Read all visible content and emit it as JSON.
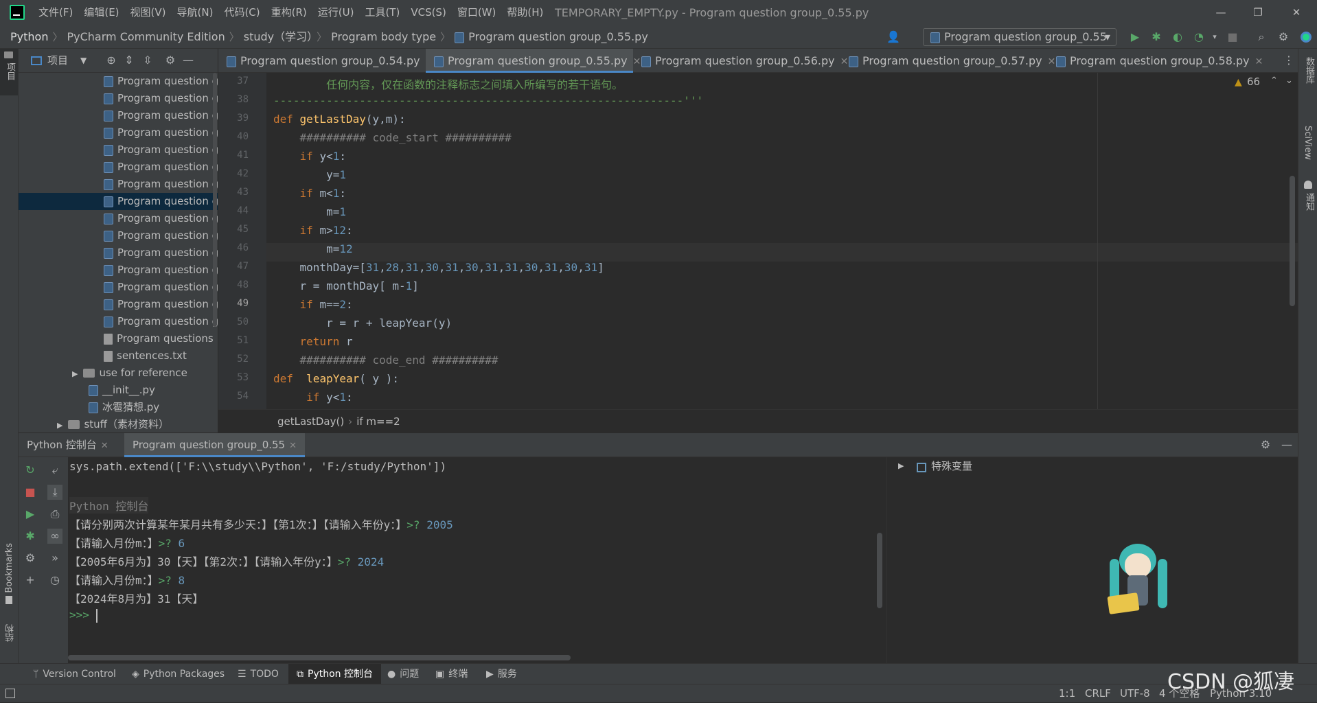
{
  "window": {
    "title": "TEMPORARY_EMPTY.py - Program question group_0.55.py",
    "menu": [
      "文件(F)",
      "编辑(E)",
      "视图(V)",
      "导航(N)",
      "代码(C)",
      "重构(R)",
      "运行(U)",
      "工具(T)",
      "VCS(S)",
      "窗口(W)",
      "帮助(H)"
    ],
    "minimize": "—",
    "restore": "❐",
    "close": "✕"
  },
  "breadcrumb": {
    "items": [
      "Python",
      "PyCharm Community Edition",
      "study（学习）",
      "Program body type",
      "Program question group_0.55.py"
    ]
  },
  "run_config": {
    "label": "Program question group_0.55",
    "dropdown_arrow": "▾"
  },
  "project_panel": {
    "title": "项目",
    "tree": [
      {
        "label": "Program question g",
        "kind": "py"
      },
      {
        "label": "Program question g",
        "kind": "py"
      },
      {
        "label": "Program question g",
        "kind": "py"
      },
      {
        "label": "Program question g",
        "kind": "py"
      },
      {
        "label": "Program question g",
        "kind": "py"
      },
      {
        "label": "Program question g",
        "kind": "py"
      },
      {
        "label": "Program question g",
        "kind": "py"
      },
      {
        "label": "Program question g",
        "kind": "py",
        "selected": true
      },
      {
        "label": "Program question g",
        "kind": "py"
      },
      {
        "label": "Program question g",
        "kind": "py"
      },
      {
        "label": "Program question g",
        "kind": "py"
      },
      {
        "label": "Program question g",
        "kind": "py"
      },
      {
        "label": "Program question g",
        "kind": "py"
      },
      {
        "label": "Program question g",
        "kind": "py"
      },
      {
        "label": "Program question g",
        "kind": "py"
      },
      {
        "label": "Program questions",
        "kind": "txt"
      },
      {
        "label": "sentences.txt",
        "kind": "txt"
      },
      {
        "label": "use for reference",
        "kind": "folder"
      },
      {
        "label": "__init__.py",
        "kind": "py"
      },
      {
        "label": "冰雹猜想.py",
        "kind": "py"
      },
      {
        "label": "stuff（素材资料）",
        "kind": "folder"
      }
    ]
  },
  "left_toolbar": {
    "project_label": "项目",
    "bookmarks_label": "Bookmarks",
    "structure_label": "结构"
  },
  "right_toolbar": {
    "database_label": "数据库",
    "sciview_label": "SciView",
    "notifications_label": "通知"
  },
  "tabs": [
    {
      "label": "Program question group_0.54.py",
      "active": false
    },
    {
      "label": "Program question group_0.55.py",
      "active": true
    },
    {
      "label": "Program question group_0.56.py",
      "active": false
    },
    {
      "label": "Program question group_0.57.py",
      "active": false
    },
    {
      "label": "Program question group_0.58.py",
      "active": false
    }
  ],
  "editor": {
    "warnings_count": "66",
    "line_numbers": [
      "37",
      "38",
      "39",
      "40",
      "41",
      "42",
      "43",
      "44",
      "45",
      "46",
      "47",
      "48",
      "49",
      "50",
      "51",
      "52",
      "53",
      "54"
    ],
    "code_lines": [
      "        任何内容，仅在函数的注释标志之间填入所编写的若干语句。",
      "--------------------------------------------------------------'''",
      "def getLastDay(y,m):",
      "    ########## code_start ##########",
      "    if y<1:",
      "        y=1",
      "    if m<1:",
      "        m=1",
      "    if m>12:",
      "        m=12",
      "    monthDay=[31,28,31,30,31,30,31,31,30,31,30,31]",
      "    r = monthDay[ m-1]",
      "    if m==2:",
      "        r = r + leapYear(y)",
      "    return r",
      "    ########## code_end ##########",
      "def  leapYear( y ):",
      "     if y<1:"
    ],
    "breadcrumb": [
      "getLastDay()",
      "if m==2"
    ]
  },
  "console": {
    "tabs": [
      "Python 控制台",
      "Program question group_0.55"
    ],
    "lines": [
      {
        "text": "sys.path.extend(['F:\\\\study\\\\Python', 'F:/study/Python'])"
      },
      {
        "text": ""
      },
      {
        "text": "Python 控制台"
      },
      {
        "text": "【请分别两次计算某年某月共有多少天：】【第1次：】【请输入年份y：】",
        "prompt": ">? ",
        "input": "2005"
      },
      {
        "text": "【请输入月份m：】",
        "prompt": ">? ",
        "input": "6"
      },
      {
        "text": "【2005年6月为】30【天】【第2次：】【请输入年份y：】",
        "prompt": ">? ",
        "input": "2024"
      },
      {
        "text": "【请输入月份m：】",
        "prompt": ">? ",
        "input": "8"
      },
      {
        "text": "【2024年8月为】31【天】"
      },
      {
        "text": "",
        "prompt": ">>> ",
        "input": ""
      }
    ],
    "variables_label": "特殊变量"
  },
  "bottom_tabs": [
    "Version Control",
    "Python Packages",
    "TODO",
    "Python 控制台",
    "问题",
    "终端",
    "服务"
  ],
  "status": {
    "position": "1:1",
    "line_sep": "CRLF",
    "encoding": "UTF-8",
    "indent": "4 个空格",
    "interpreter": "Python 3.10"
  },
  "watermark": "CSDN @狐凄",
  "colors": {
    "accent": "#4a88c7",
    "keyword": "#cc7832",
    "function": "#ffc66d",
    "number": "#6897bb",
    "prompt": "#59a869"
  }
}
